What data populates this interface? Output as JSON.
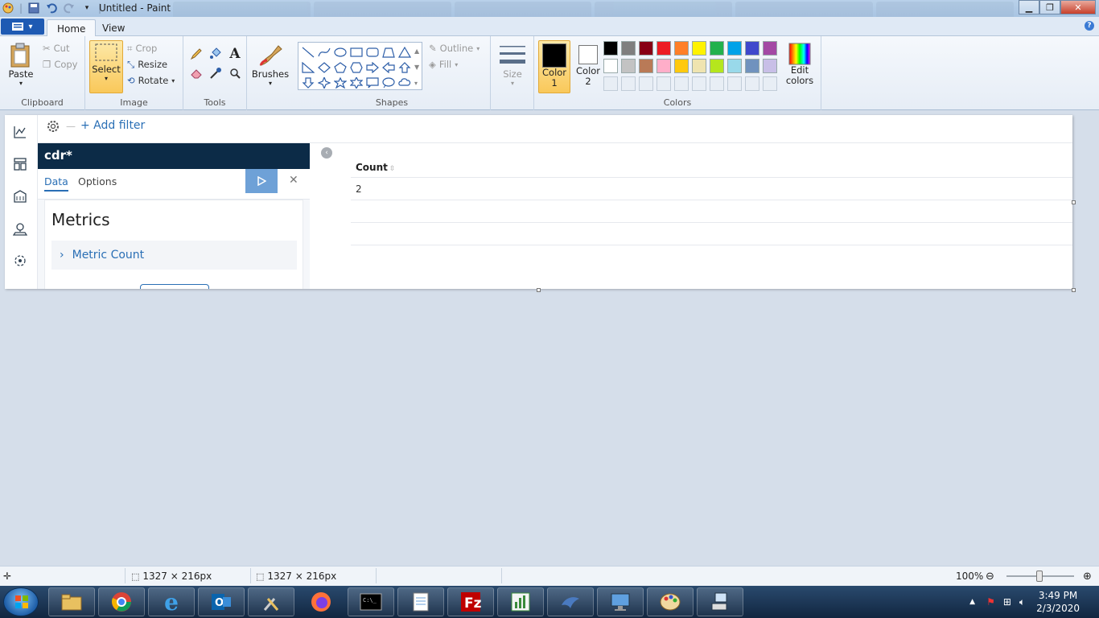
{
  "window": {
    "title": "Untitled - Paint"
  },
  "ribbon": {
    "tabs": [
      "Home",
      "View"
    ],
    "clipboard": {
      "paste": "Paste",
      "cut": "Cut",
      "copy": "Copy",
      "label": "Clipboard"
    },
    "image": {
      "select": "Select",
      "crop": "Crop",
      "resize": "Resize",
      "rotate": "Rotate",
      "label": "Image"
    },
    "tools": {
      "label": "Tools"
    },
    "brushes": {
      "label": "Brushes"
    },
    "shapes": {
      "outline": "Outline",
      "fill": "Fill",
      "label": "Shapes"
    },
    "size": {
      "label": "Size"
    },
    "colors": {
      "color1": "Color 1",
      "color2": "Color 2",
      "edit": "Edit colors",
      "label": "Colors",
      "color1_value": "#000000",
      "color2_value": "#ffffff",
      "palette_row1": [
        "#000000",
        "#7f7f7f",
        "#880015",
        "#ed1c24",
        "#ff7f27",
        "#fff200",
        "#22b14c",
        "#00a2e8",
        "#3f48cc",
        "#a349a4"
      ],
      "palette_row2": [
        "#ffffff",
        "#c3c3c3",
        "#b97a57",
        "#ffaec9",
        "#ffc90e",
        "#efe4b0",
        "#b5e61d",
        "#99d9ea",
        "#7092be",
        "#c8bfe7"
      ]
    }
  },
  "canvas": {
    "filter_bar": {
      "add_filter": "+ Add filter"
    },
    "editor": {
      "index_pattern": "cdr*",
      "tab_data": "Data",
      "tab_options": "Options",
      "metrics_title": "Metrics",
      "metric_item": "Metric Count"
    },
    "table": {
      "column": "Count",
      "rows": [
        "2",
        "",
        "",
        ""
      ]
    }
  },
  "statusbar": {
    "selection_size": "1327 × 216px",
    "image_size": "1327 × 216px",
    "zoom": "100%"
  },
  "taskbar": {
    "time": "3:49 PM",
    "date": "2/3/2020"
  }
}
